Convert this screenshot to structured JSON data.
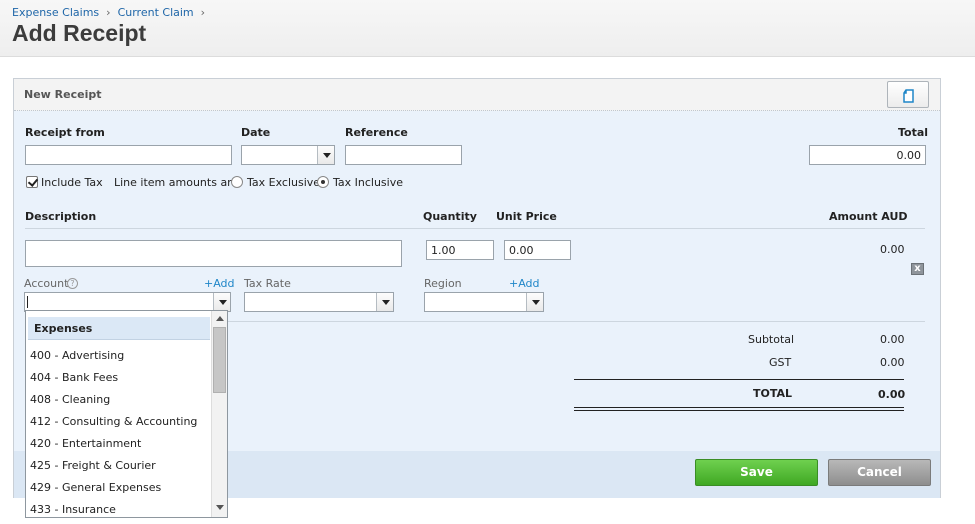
{
  "breadcrumb": {
    "item1": "Expense Claims",
    "item2": "Current Claim",
    "separator": "›"
  },
  "page_title": "Add Receipt",
  "panel": {
    "title": "New Receipt",
    "copy_icon": "document-icon"
  },
  "form": {
    "receipt_from_label": "Receipt from",
    "receipt_from_value": "",
    "date_label": "Date",
    "date_value": "",
    "reference_label": "Reference",
    "reference_value": "",
    "total_label": "Total",
    "total_value": "0.00",
    "include_tax_label": "Include Tax",
    "include_tax_checked": true,
    "line_item_label": "Line item amounts are:",
    "tax_exclusive_label": "Tax Exclusive",
    "tax_inclusive_label": "Tax Inclusive",
    "selected_tax_mode": "Tax Inclusive"
  },
  "line_items": {
    "description_header": "Description",
    "quantity_header": "Quantity",
    "unit_price_header": "Unit Price",
    "amount_header": "Amount AUD",
    "description_value": "",
    "quantity_value": "1.00",
    "unit_price_value": "0.00",
    "amount_value": "0.00",
    "account_label": "Account",
    "account_add": "+Add",
    "tax_rate_label": "Tax Rate",
    "region_label": "Region",
    "region_add": "+Add",
    "delete_icon": "x"
  },
  "totals": {
    "subtotal_label": "Subtotal",
    "subtotal_value": "0.00",
    "gst_label": "GST",
    "gst_value": "0.00",
    "total_label": "TOTAL",
    "total_value": "0.00"
  },
  "buttons": {
    "save": "Save",
    "cancel": "Cancel"
  },
  "account_dropdown": {
    "group": "Expenses",
    "items": [
      "400 - Advertising",
      "404 - Bank Fees",
      "408 - Cleaning",
      "412 - Consulting & Accounting",
      "420 - Entertainment",
      "425 - Freight & Courier",
      "429 - General Expenses",
      "433 - Insurance"
    ]
  },
  "colors": {
    "link": "#1f66a8",
    "save": "#4cb52e",
    "cancel": "#9e9e9e",
    "panel_bg": "#eaf2fb"
  }
}
